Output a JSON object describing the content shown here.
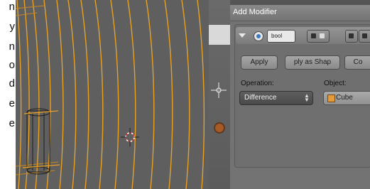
{
  "left_strip": {
    "letters": [
      "n",
      "y",
      "n",
      "o",
      "d",
      "e",
      "e"
    ]
  },
  "panel": {
    "title": "Add Modifier",
    "modifier": {
      "name": "bool",
      "buttons": {
        "apply": "Apply",
        "apply_shape": "ply as Shap",
        "copy": "Co"
      },
      "operation_label": "Operation:",
      "operation_value": "Difference",
      "object_label": "Object:",
      "object_value": "Cube"
    }
  },
  "colors": {
    "wire": "#e8a023",
    "viewport_bg": "#5f5f5f",
    "panel_bg": "#737373"
  }
}
